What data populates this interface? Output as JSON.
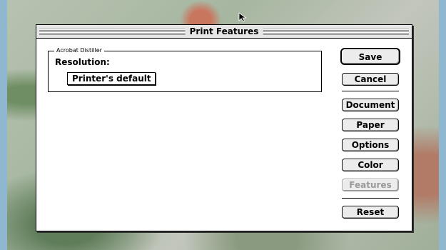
{
  "window": {
    "title": "Print Features"
  },
  "group": {
    "label": "Acrobat Distiller",
    "resolution_label": "Resolution:",
    "resolution_value": "Printer's default"
  },
  "buttons": {
    "save": "Save",
    "cancel": "Cancel",
    "document": "Document",
    "paper": "Paper",
    "options": "Options",
    "color": "Color",
    "features": "Features",
    "reset": "Reset"
  },
  "icons": {
    "cursor": "arrow-cursor-icon"
  }
}
